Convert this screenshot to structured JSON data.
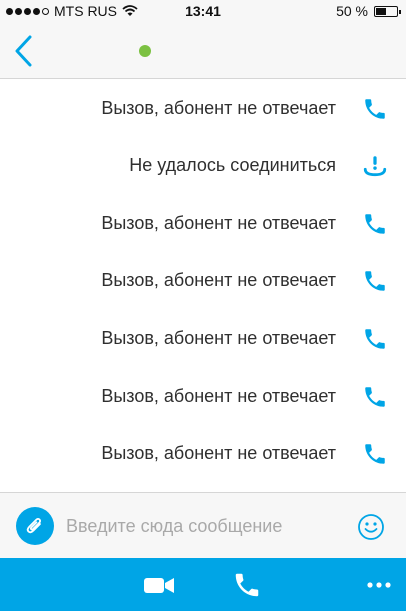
{
  "status_bar": {
    "carrier": "MTS RUS",
    "time": "13:41",
    "battery_text": "50 %",
    "battery_level": 0.5,
    "signal_bars_filled": 4,
    "signal_bars_total": 5,
    "wifi_icon": "wifi-icon"
  },
  "header": {
    "back_icon": "chevron-left-icon",
    "presence_status_color": "#7cc142"
  },
  "messages": [
    {
      "text": "Вызов, абонент не отвечает",
      "icon": "phone-icon"
    },
    {
      "text": "Не удалось соединиться",
      "icon": "call-failed-icon"
    },
    {
      "text": "Вызов, абонент не отвечает",
      "icon": "phone-icon"
    },
    {
      "text": "Вызов, абонент не отвечает",
      "icon": "phone-icon"
    },
    {
      "text": "Вызов, абонент не отвечает",
      "icon": "phone-icon"
    },
    {
      "text": "Вызов, абонент не отвечает",
      "icon": "phone-icon"
    },
    {
      "text": "Вызов, абонент не отвечает",
      "icon": "phone-icon"
    }
  ],
  "composer": {
    "attach_icon": "paperclip-icon",
    "placeholder": "Введите сюда сообщение",
    "emoji_icon": "smiley-icon"
  },
  "toolbar": {
    "video_icon": "video-camera-icon",
    "call_icon": "phone-icon",
    "more_icon": "more-dots-icon"
  },
  "colors": {
    "accent": "#00a5e6",
    "bar_background": "#f7f7f7",
    "online": "#7cc142"
  }
}
